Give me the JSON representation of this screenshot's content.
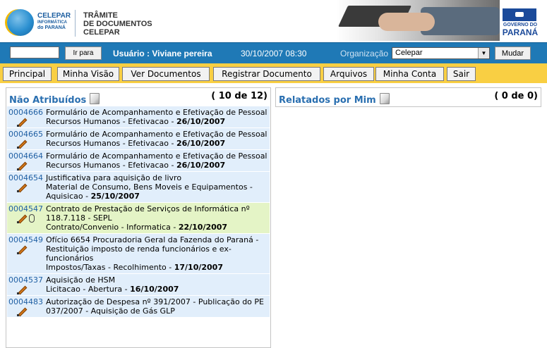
{
  "header": {
    "logo": {
      "line1": "CELEPAR",
      "line2": "INFORMÁTICA",
      "line3": "do PARANÁ"
    },
    "app_title": [
      "TRÂMITE",
      "DE DOCUMENTOS",
      "CELEPAR"
    ],
    "gov_logo": {
      "line1": "GOVERNO DO",
      "line2": "PARANÁ"
    }
  },
  "toolbar": {
    "goto_value": "",
    "goto_button": "Ir para",
    "user": "Usuário : Viviane pereira",
    "datetime": "30/10/2007 08:30",
    "org_label": "Organização",
    "org_value": "Celepar",
    "change_button": "Mudar"
  },
  "nav": [
    "Principal",
    "Minha Visão",
    "Ver Documentos",
    "Registrar Documento",
    "Arquivos",
    "Minha Conta",
    "Sair"
  ],
  "unassigned": {
    "title": "Não Atribuídos",
    "count": "( 10 de 12)",
    "items": [
      {
        "id": "0004666",
        "title": "Formulário de Acompanhamento e Efetivação de Pessoal",
        "category": "Recursos Humanos - Efetivacao - ",
        "date": "26/10/2007",
        "attachment": false,
        "highlight": false
      },
      {
        "id": "0004665",
        "title": "Formulário de Acompanhamento e Efetivação de Pessoal",
        "category": "Recursos Humanos - Efetivacao - ",
        "date": "26/10/2007",
        "attachment": false,
        "highlight": false
      },
      {
        "id": "0004664",
        "title": "Formulário de Acompanhamento e Efetivação de Pessoal",
        "category": "Recursos Humanos - Efetivacao - ",
        "date": "26/10/2007",
        "attachment": false,
        "highlight": false
      },
      {
        "id": "0004654",
        "title": "Justificativa para aquisição de livro",
        "category": "Material de Consumo, Bens Moveis e Equipamentos - Aquisicao - ",
        "date": "25/10/2007",
        "attachment": false,
        "highlight": false
      },
      {
        "id": "0004547",
        "title": "Contrato de Prestação de Serviços de Informática nº 118.7.118 - SEPL",
        "category": "Contrato/Convenio - Informatica - ",
        "date": "22/10/2007",
        "attachment": true,
        "highlight": true
      },
      {
        "id": "0004549",
        "title": "Ofício 6654 Procuradoria Geral da Fazenda do Paraná - Restituição imposto de renda funcionários e ex-funcionários",
        "category": "Impostos/Taxas - Recolhimento - ",
        "date": "17/10/2007",
        "attachment": false,
        "highlight": false
      },
      {
        "id": "0004537",
        "title": "Aquisição de HSM",
        "category": "Licitacao - Abertura - ",
        "date": "16/10/2007",
        "attachment": false,
        "highlight": false
      },
      {
        "id": "0004483",
        "title": "Autorização de Despesa nº 391/2007 - Publicação do PE 037/2007 - Aquisição de Gás GLP",
        "category": "",
        "date": "",
        "attachment": false,
        "highlight": false
      }
    ]
  },
  "reported": {
    "title": "Relatados por Mim",
    "count": "( 0 de 0)"
  },
  "icons": {
    "edit": "pencil-icon",
    "attachment": "paperclip-icon",
    "panel": "document-icon"
  }
}
